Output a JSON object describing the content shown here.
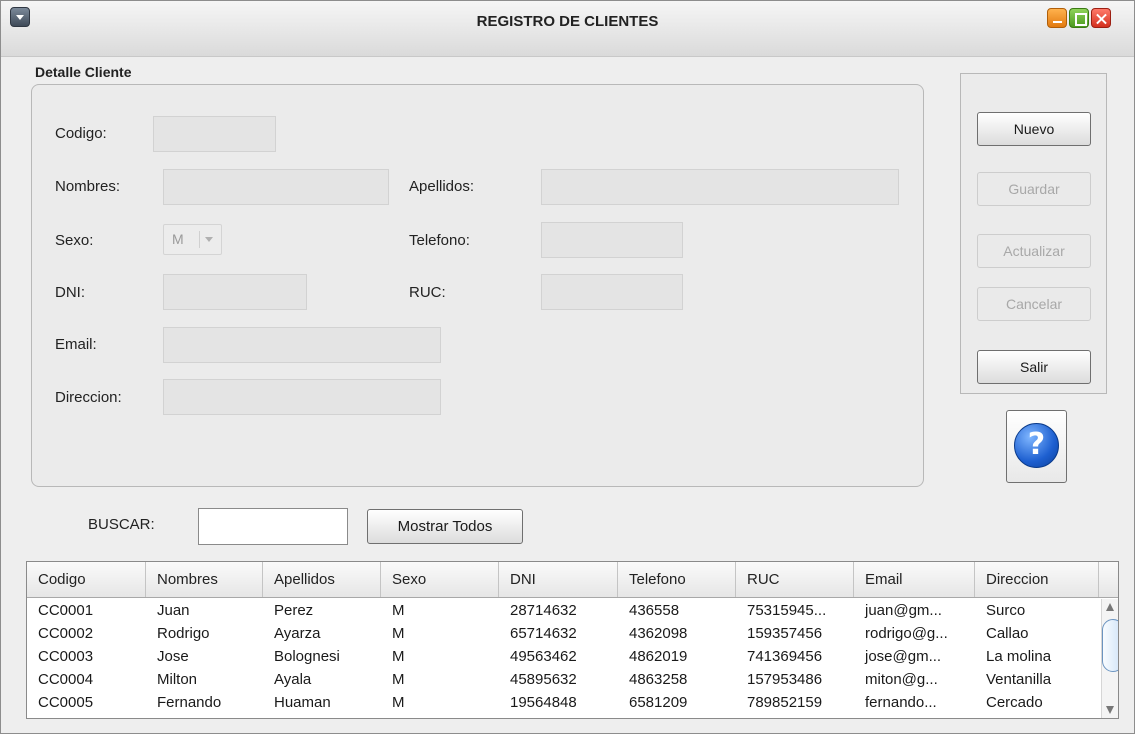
{
  "window": {
    "title": "REGISTRO DE CLIENTES",
    "colors": {
      "minimize": "#f08c1f",
      "maximize": "#5eb02c",
      "close": "#e03b28"
    }
  },
  "detail": {
    "group_title": "Detalle Cliente",
    "fields": {
      "codigo": {
        "label": "Codigo:",
        "value": ""
      },
      "nombres": {
        "label": "Nombres:",
        "value": ""
      },
      "apellidos": {
        "label": "Apellidos:",
        "value": ""
      },
      "sexo": {
        "label": "Sexo:",
        "value": "M"
      },
      "telefono": {
        "label": "Telefono:",
        "value": ""
      },
      "dni": {
        "label": "DNI:",
        "value": ""
      },
      "ruc": {
        "label": "RUC:",
        "value": ""
      },
      "email": {
        "label": "Email:",
        "value": ""
      },
      "direccion": {
        "label": "Direccion:",
        "value": ""
      }
    }
  },
  "actions": {
    "nuevo": {
      "label": "Nuevo",
      "enabled": true
    },
    "guardar": {
      "label": "Guardar",
      "enabled": false
    },
    "actualizar": {
      "label": "Actualizar",
      "enabled": false
    },
    "cancelar": {
      "label": "Cancelar",
      "enabled": false
    },
    "salir": {
      "label": "Salir",
      "enabled": true
    },
    "help_icon": "question-mark-icon",
    "help_glyph": "?"
  },
  "search": {
    "label": "BUSCAR:",
    "value": "",
    "show_all_label": "Mostrar Todos"
  },
  "table": {
    "columns": [
      "Codigo",
      "Nombres",
      "Apellidos",
      "Sexo",
      "DNI",
      "Telefono",
      "RUC",
      "Email",
      "Direccion"
    ],
    "rows": [
      [
        "CC0001",
        "Juan",
        "Perez",
        "M",
        "28714632",
        "436558",
        "75315945...",
        "juan@gm...",
        "Surco"
      ],
      [
        "CC0002",
        "Rodrigo",
        "Ayarza",
        "M",
        "65714632",
        "4362098",
        "159357456",
        "rodrigo@g...",
        "Callao"
      ],
      [
        "CC0003",
        "Jose",
        "Bolognesi",
        "M",
        "49563462",
        "4862019",
        "741369456",
        "jose@gm...",
        "La molina"
      ],
      [
        "CC0004",
        "Milton",
        "Ayala",
        "M",
        "45895632",
        "4863258",
        "157953486",
        "miton@g...",
        "Ventanilla"
      ],
      [
        "CC0005",
        "Fernando",
        "Huaman",
        "M",
        "19564848",
        "6581209",
        "789852159",
        "fernando...",
        "Cercado"
      ]
    ]
  }
}
